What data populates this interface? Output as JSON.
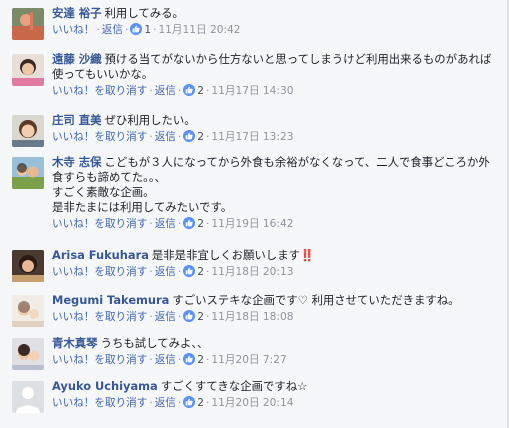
{
  "labels": {
    "like": "いいね！",
    "unlike": "いいね！を取り消す",
    "reply": "返信",
    "separator": "·"
  },
  "colors": {
    "link": "#4267b2",
    "name": "#365899",
    "like_badge": "#5890ff",
    "timestamp": "#90949c",
    "background": "#f6f7f9"
  },
  "comments": [
    {
      "name": "安達 裕子",
      "lines": [
        "利用してみる。"
      ],
      "like_action": "いいね！",
      "reactions": "1",
      "timestamp": "11月11日 20:42"
    },
    {
      "name": "遠藤 沙織",
      "lines": [
        "預ける当てがないから仕方ないと思ってしまうけど利用出来るものがあれば使ってもいいかな。"
      ],
      "like_action": "いいね！を取り消す",
      "reactions": "2",
      "timestamp": "11月17日 14:30"
    },
    {
      "name": "庄司 直美",
      "lines": [
        "ぜひ利用したい。"
      ],
      "like_action": "いいね！を取り消す",
      "reactions": "2",
      "timestamp": "11月17日 13:23"
    },
    {
      "name": "木寺 志保",
      "lines": [
        "こどもが３人になってから外食も余裕がなくなって、二人で食事どころか外食すらも諦めてた。。、",
        "すごく素敵な企画。",
        "是非たまには利用してみたいです。"
      ],
      "like_action": "いいね！を取り消す",
      "reactions": "2",
      "timestamp": "11月19日 16:42"
    },
    {
      "name": "Arisa Fukuhara",
      "lines": [
        "是非是非宜しくお願いします‼️"
      ],
      "like_action": "いいね！を取り消す",
      "reactions": "2",
      "timestamp": "11月18日 20:13"
    },
    {
      "name": "Megumi Takemura",
      "lines": [
        "すごいステキな企画です♡ 利用させていただきますね。"
      ],
      "like_action": "いいね！を取り消す",
      "reactions": "2",
      "timestamp": "11月18日 18:08"
    },
    {
      "name": "青木真琴",
      "lines": [
        "うちも試してみよ、、"
      ],
      "like_action": "いいね！を取り消す",
      "reactions": "2",
      "timestamp": "11月20日 7:27"
    },
    {
      "name": "Ayuko Uchiyama",
      "lines": [
        "すごくすてきな企画ですね☆"
      ],
      "like_action": "いいね！を取り消す",
      "reactions": "2",
      "timestamp": "11月20日 20:14"
    }
  ]
}
